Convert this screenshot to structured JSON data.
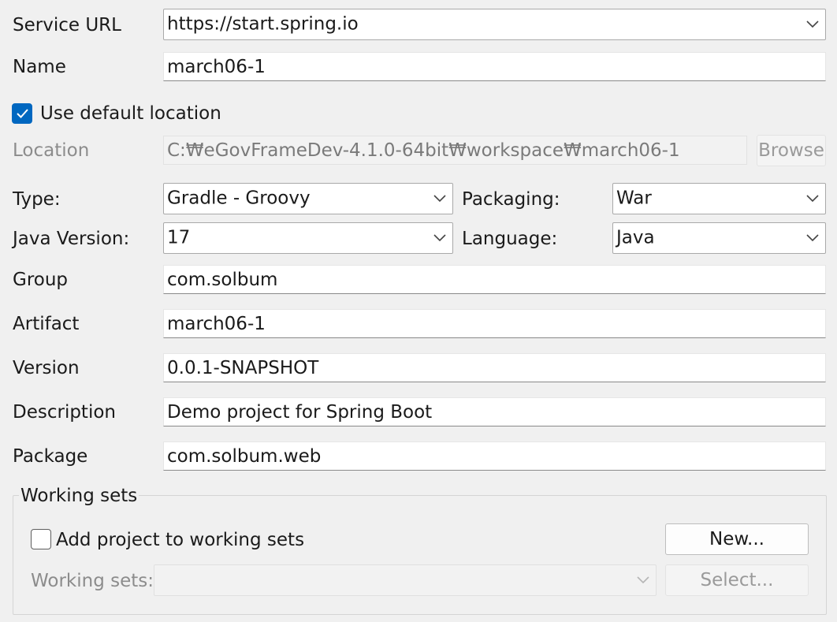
{
  "service_url": {
    "label": "Service URL",
    "value": "https://start.spring.io"
  },
  "name": {
    "label": "Name",
    "value": "march06-1"
  },
  "use_default_location": {
    "label": "Use default location",
    "checked": true
  },
  "location": {
    "label": "Location",
    "value": "C:₩eGovFrameDev-4.1.0-64bit₩workspace₩march06-1",
    "browse_label": "Browse"
  },
  "type": {
    "label": "Type:",
    "value": "Gradle - Groovy"
  },
  "packaging": {
    "label": "Packaging:",
    "value": "War"
  },
  "java_version": {
    "label": "Java Version:",
    "value": "17"
  },
  "language": {
    "label": "Language:",
    "value": "Java"
  },
  "group": {
    "label": "Group",
    "value": "com.solbum"
  },
  "artifact": {
    "label": "Artifact",
    "value": "march06-1"
  },
  "version": {
    "label": "Version",
    "value": "0.0.1-SNAPSHOT"
  },
  "description": {
    "label": "Description",
    "value": "Demo project for Spring Boot"
  },
  "package": {
    "label": "Package",
    "value": "com.solbum.web"
  },
  "working_sets": {
    "group_title": "Working sets",
    "add_label": "Add project to working sets",
    "add_checked": false,
    "new_label": "New...",
    "sets_label": "Working sets:",
    "sets_value": "",
    "select_label": "Select..."
  },
  "colors": {
    "accent": "#0067c0",
    "background": "#f0f0f0",
    "disabled_text": "#8c8c8c"
  },
  "icons": {
    "dropdown": "chevron-down-icon",
    "check": "checkmark-icon"
  }
}
